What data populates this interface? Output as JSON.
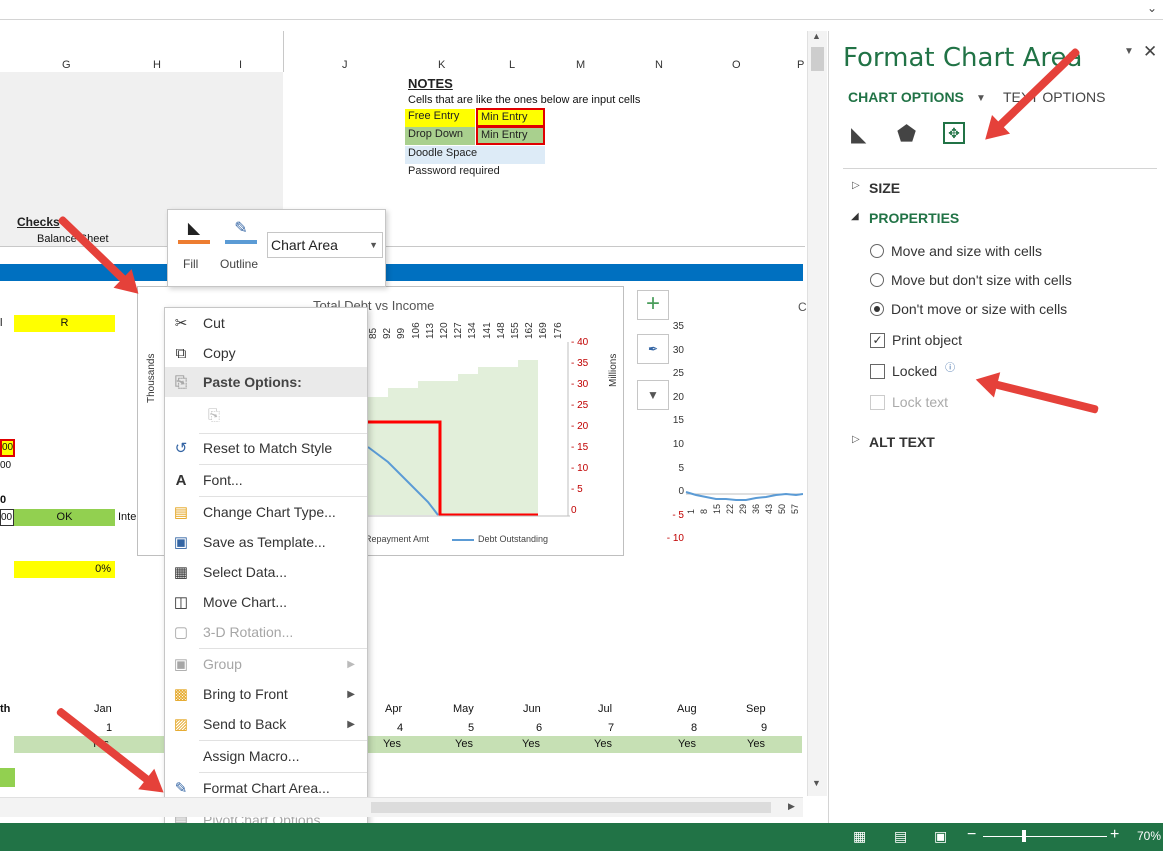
{
  "panel": {
    "title": "Format Chart Area",
    "tab_chart_options": "CHART OPTIONS",
    "tab_text_options": "TEXT OPTIONS",
    "section_size": "SIZE",
    "section_properties": "PROPERTIES",
    "opt_move_size": "Move and size with cells",
    "opt_move_no_size": "Move but don't size with cells",
    "opt_no_move": "Don't move or size with cells",
    "print_object": "Print object",
    "locked": "Locked",
    "lock_text": "Lock text",
    "section_alt_text": "ALT TEXT"
  },
  "columns": [
    "G",
    "H",
    "I",
    "J",
    "K",
    "L",
    "M",
    "N",
    "O",
    "P"
  ],
  "notes": {
    "title": "NOTES",
    "desc": "Cells that are like the ones below are input cells",
    "free_entry": "Free Entry",
    "min_entry": "Min Entry",
    "drop_down": "Drop Down",
    "min_entry2": "Min Entry",
    "doodle": "Doodle Space",
    "password": "Password required"
  },
  "sheet": {
    "checks": "Checks",
    "balance_sheet": "Balance Sheet",
    "cell_r": "R",
    "cell_ok": "OK",
    "cell_pct": "0%",
    "cell_00a": "00",
    "cell_00b": "00",
    "cell_00c": "00",
    "cell_0": "0",
    "cell_l": "l",
    "cell_inte": "Inte",
    "cell_th": "th",
    "months": [
      "Jan",
      "Apr",
      "May",
      "Jun",
      "Jul",
      "Aug",
      "Sep"
    ],
    "month_nums": [
      "1",
      "4",
      "5",
      "6",
      "7",
      "8",
      "9"
    ],
    "yes": "Yes"
  },
  "mini_toolbar": {
    "fill": "Fill",
    "outline": "Outline",
    "dropdown": "Chart Area"
  },
  "chart1": {
    "title": "Total Debt vs Income",
    "y_left_label": "Thousands",
    "y_right_label": "Millions",
    "x_ticks": [
      "85",
      "92",
      "99",
      "106",
      "113",
      "120",
      "127",
      "134",
      "141",
      "148",
      "155",
      "162",
      "169",
      "176"
    ],
    "y_right_ticks": [
      "- 40",
      "- 35",
      "- 30",
      "- 25",
      "- 20",
      "- 15",
      "- 10",
      "- 5",
      "0"
    ],
    "legend": [
      "Repayment Amt",
      "Debt Outstanding"
    ],
    "series_colors": {
      "income": "#e2efda",
      "repayment": "#ff0000",
      "debt": "#5b9bd5"
    }
  },
  "chart2": {
    "y_ticks": [
      "35",
      "30",
      "25",
      "20",
      "15",
      "10",
      "5",
      "0",
      "- 5",
      "- 10"
    ],
    "x_ticks": [
      "1",
      "8",
      "15",
      "22",
      "29",
      "36",
      "43",
      "50",
      "57"
    ]
  },
  "context_menu": {
    "cut": "Cut",
    "copy": "Copy",
    "paste_options": "Paste Options:",
    "reset": "Reset to Match Style",
    "font": "Font...",
    "change_type": "Change Chart Type...",
    "save_template": "Save as Template...",
    "select_data": "Select Data...",
    "move_chart": "Move Chart...",
    "rotation": "3-D Rotation...",
    "group": "Group",
    "bring_front": "Bring to Front",
    "send_back": "Send to Back",
    "assign_macro": "Assign Macro...",
    "format_area": "Format Chart Area...",
    "pivot_options": "PivotChart Options..."
  },
  "status": {
    "zoom": "70%"
  }
}
